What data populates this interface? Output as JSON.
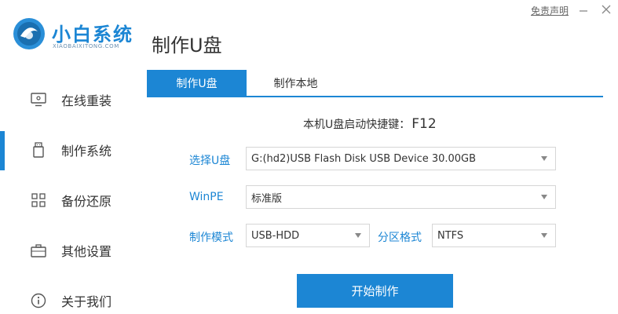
{
  "app": {
    "title": "小白系统",
    "subtitle": "XIAOBAIXITONG.COM",
    "disclaimer": "免责声明",
    "accent": "#1c86d4"
  },
  "sidebar": {
    "items": [
      {
        "label": "在线重装",
        "icon": "monitor-icon",
        "active": false
      },
      {
        "label": "制作系统",
        "icon": "usb-drive-icon",
        "active": true
      },
      {
        "label": "备份还原",
        "icon": "grid-icon",
        "active": false
      },
      {
        "label": "其他设置",
        "icon": "briefcase-icon",
        "active": false
      },
      {
        "label": "关于我们",
        "icon": "info-icon",
        "active": false
      }
    ]
  },
  "main": {
    "page_title": "制作U盘",
    "tabs": [
      {
        "label": "制作U盘",
        "active": true
      },
      {
        "label": "制作本地",
        "active": false
      }
    ],
    "hotkey": {
      "label": "本机U盘启动快捷键：",
      "key": "F12"
    },
    "form": {
      "usb_label": "选择U盘",
      "usb_value": "G:(hd2)USB Flash Disk USB Device 30.00GB",
      "winpe_label": "WinPE",
      "winpe_value": "标准版",
      "mode_label": "制作模式",
      "mode_value": "USB-HDD",
      "format_label": "分区格式",
      "format_value": "NTFS"
    },
    "start_button": "开始制作"
  }
}
